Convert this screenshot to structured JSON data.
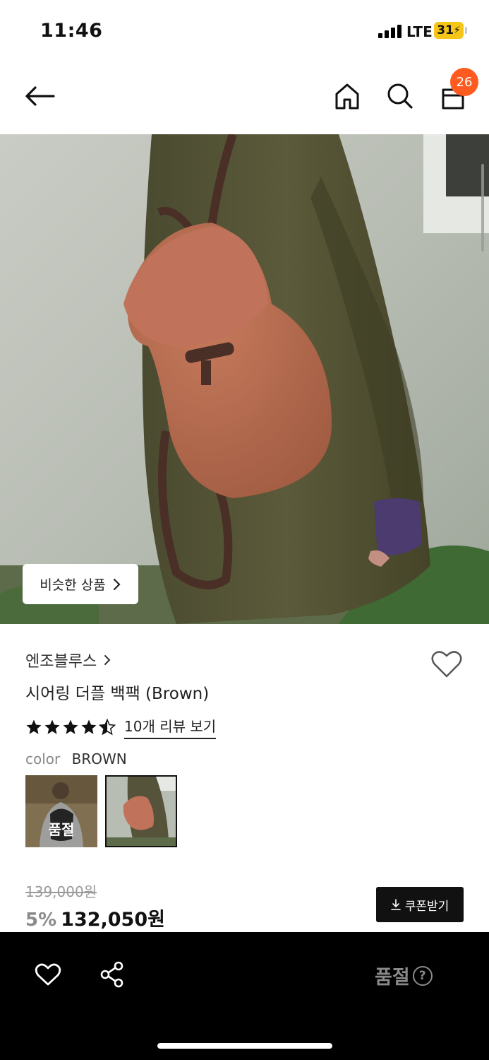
{
  "status_bar": {
    "time": "11:46",
    "network": "LTE",
    "battery": "31"
  },
  "header": {
    "cart_count": "26"
  },
  "hero": {
    "similar_label": "비슷한 상품"
  },
  "product": {
    "brand": "엔조블루스",
    "name": "시어링 더플 백팩 (Brown)",
    "rating": 4.5,
    "review_link": "10개 리뷰 보기",
    "color_label": "color",
    "color_value": "BROWN",
    "swatches": [
      {
        "overlay": "품절",
        "selected": false
      },
      {
        "overlay": "",
        "selected": true
      }
    ]
  },
  "price": {
    "original": "139,000원",
    "discount": "5%",
    "sale": "132,050원",
    "coupon_label": "쿠폰받기"
  },
  "bottom_bar": {
    "status": "품절",
    "help": "?"
  },
  "colors": {
    "badge": "#ff5a1f",
    "bar": "#000000",
    "muted": "#8a8a8a"
  }
}
